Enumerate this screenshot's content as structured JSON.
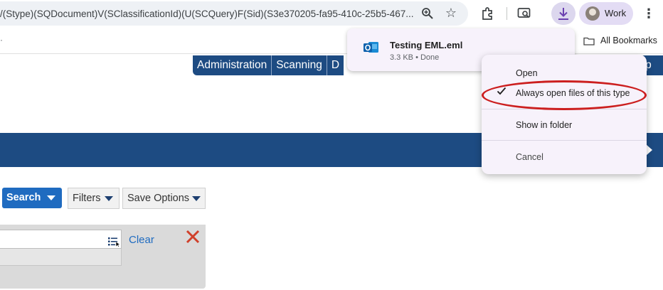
{
  "browser": {
    "url_text": "/(Stype)(SQDocument)V(SClassificationId)(U(SCQuery)F(Sid)(S3e370205-fa95-410c-25b5-467...",
    "profile_label": "Work",
    "bookmarks_label": "All Bookmarks"
  },
  "app": {
    "nav_tabs": [
      {
        "label": "Administration"
      },
      {
        "label": "Scanning"
      },
      {
        "label": "D"
      }
    ],
    "nav_help_partial": "elp",
    "toolbar": {
      "search_label": "Search",
      "filters_label": "Filters",
      "save_options_label": "Save Options"
    },
    "query_panel": {
      "clear_label": "Clear"
    }
  },
  "download_popup": {
    "filename": "Testing EML.eml",
    "status": "3.3 KB • Done"
  },
  "context_menu": {
    "items": [
      {
        "label": "Open"
      },
      {
        "label": "Always open files of this type",
        "checked": true
      },
      {
        "label": "Show in folder"
      },
      {
        "label": "Cancel"
      }
    ]
  },
  "colors": {
    "app_blue": "#1d4b82",
    "search_blue": "#1f6bc0",
    "annotation_red": "#cc1f1f",
    "menu_bg": "#f7f2fb"
  },
  "icons": [
    "zoom-icon",
    "star-icon",
    "extensions-icon",
    "cast-icon",
    "download-icon",
    "avatar",
    "menu-icon",
    "folder-icon",
    "outlook-icon",
    "check-icon",
    "list-icon",
    "close-icon"
  ]
}
